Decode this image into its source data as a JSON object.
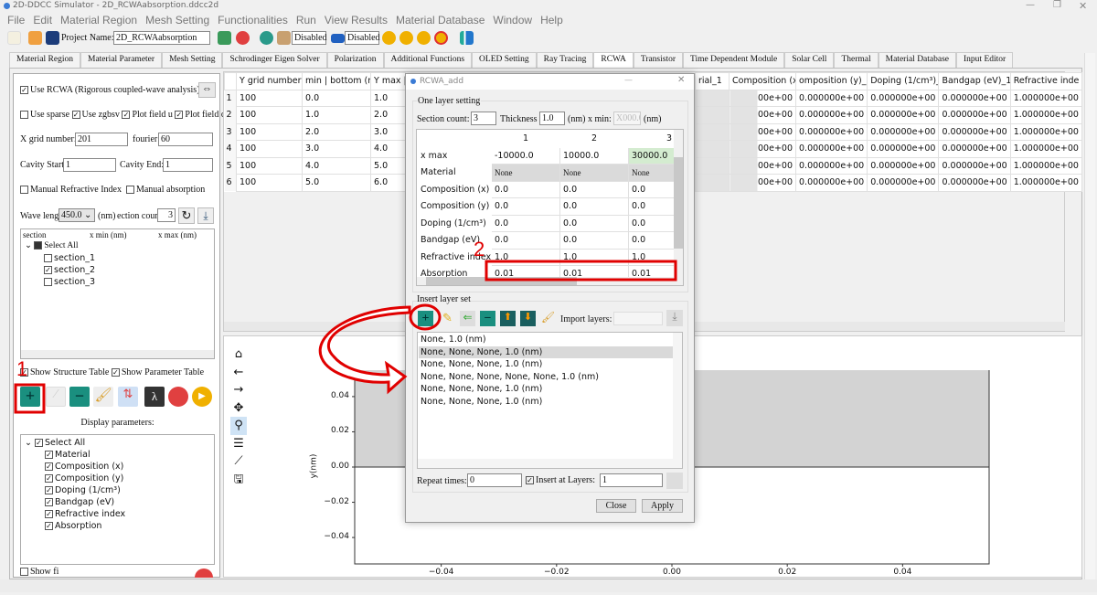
{
  "window": {
    "title": "2D-DDCC Simulator - 2D_RCWAabsorption.ddcc2d"
  },
  "menu": [
    "File",
    "Edit",
    "Material Region",
    "Mesh Setting",
    "Functionalities",
    "Run",
    "View Results",
    "Material Database",
    "Window",
    "Help"
  ],
  "toolbar": {
    "project_label": "Project Name:",
    "project_name": "2D_RCWAabsorption",
    "disabled_1": "Disabled",
    "disabled_2": "Disabled"
  },
  "tabs": [
    "Material Region",
    "Material Parameter",
    "Mesh Setting",
    "Schrodinger Eigen Solver",
    "Polarization",
    "Additional Functions",
    "OLED Setting",
    "Ray Tracing",
    "RCWA",
    "Transistor",
    "Time Dependent Module",
    "Solar Cell",
    "Thermal",
    "Material Database",
    "Input Editor"
  ],
  "active_tab": "RCWA",
  "left": {
    "use_rcwa": "Use RCWA (Rigorous coupled-wave analysis)",
    "use_sparse": "Use sparse",
    "use_zgbsv": "Use zgbsv",
    "plot_u": "Plot field u",
    "plot_d": "Plot field d",
    "xgrid_label": "X grid number:",
    "xgrid": "201",
    "fourier_label": "fourier:",
    "fourier": "60",
    "cav_start_label": "Cavity Start:",
    "cav_start": "1",
    "cav_end_label": "Cavity End:",
    "cav_end": "1",
    "manual_ri": "Manual Refractive Index",
    "manual_abs": "Manual absorption",
    "wave_label": "Wave lengt",
    "wave": "450.0",
    "nm": "(nm)",
    "section_count_label": "ection coun",
    "section_count": "3",
    "section_tree": {
      "headers": [
        "section",
        "x min (nm)",
        "x max (nm)"
      ],
      "select_all": "Select All",
      "items": [
        {
          "label": "section_1",
          "checked": false
        },
        {
          "label": "section_2",
          "checked": true
        },
        {
          "label": "section_3",
          "checked": false
        }
      ]
    },
    "show_structure": "Show Structure Table",
    "show_parameter": "Show Parameter Table",
    "display_label": "Display parameters:",
    "display_tree": {
      "select_all": "Select All",
      "items": [
        "Material",
        "Composition (x)",
        "Composition (y)",
        "Doping (1/cm³)",
        "Bandgap (eV)",
        "Refractive index",
        "Absorption"
      ]
    },
    "bottom_cut": "Show fi"
  },
  "main_table": {
    "headers": [
      "Y grid number",
      "min | bottom (nr",
      "Y max | t"
    ],
    "rows": [
      [
        "1",
        "100",
        "0.0",
        "1.0"
      ],
      [
        "2",
        "100",
        "1.0",
        "2.0"
      ],
      [
        "3",
        "100",
        "2.0",
        "3.0"
      ],
      [
        "4",
        "100",
        "3.0",
        "4.0"
      ],
      [
        "5",
        "100",
        "4.0",
        "5.0"
      ],
      [
        "6",
        "100",
        "5.0",
        "6.0"
      ]
    ],
    "right_headers": [
      "rial_1",
      "Composition (x)_",
      "omposition (y)_",
      "Doping (1/cm³)_",
      "Bandgap (eV)_1",
      "Refractive inde"
    ],
    "right_row": [
      "",
      "00e+00",
      "0.000000e+00",
      "0.000000e+00",
      "0.000000e+00",
      "1.000000e+00"
    ]
  },
  "dialog": {
    "title": "RCWA_add",
    "group1": "One layer setting",
    "section_count_label": "Section count:",
    "section_count": "3",
    "thickness_label": "Thickness",
    "thickness": "1.0",
    "nm_xmin": "(nm) x min:",
    "xmin": "X000.0",
    "nm": "(nm)",
    "columns": [
      "1",
      "2",
      "3"
    ],
    "rows": [
      {
        "label": "x max",
        "values": [
          "-10000.0",
          "10000.0",
          "30000.0"
        ]
      },
      {
        "label": "Material",
        "values": [
          "None",
          "None",
          "None"
        ]
      },
      {
        "label": "Composition (x)",
        "values": [
          "0.0",
          "0.0",
          "0.0"
        ]
      },
      {
        "label": "Composition (y)",
        "values": [
          "0.0",
          "0.0",
          "0.0"
        ]
      },
      {
        "label": "Doping (1/cm³)",
        "values": [
          "0.0",
          "0.0",
          "0.0"
        ]
      },
      {
        "label": "Bandgap (eV)",
        "values": [
          "0.0",
          "0.0",
          "0.0"
        ]
      },
      {
        "label": "Refractive index",
        "values": [
          "1.0",
          "1.0",
          "1.0"
        ]
      },
      {
        "label": "Absorption",
        "values": [
          "0.01",
          "0.01",
          "0.01"
        ]
      }
    ],
    "group2": "Insert layer set",
    "import_label": "Import layers:",
    "layers": [
      "None,  1.0 (nm)",
      "None, None, None,  1.0 (nm)",
      "None, None, None,  1.0 (nm)",
      "None, None, None, None, None,  1.0 (nm)",
      "None, None, None,  1.0 (nm)",
      "None, None, None,  1.0 (nm)"
    ],
    "selected_layer": 1,
    "repeat_label": "Repeat times:",
    "repeat": "0",
    "insert_at_label": "Insert at Layers:",
    "insert_at": "1",
    "close": "Close",
    "apply": "Apply"
  },
  "annotations": {
    "step1": "1",
    "step2": "2",
    "color": "#e00000"
  },
  "chart_data": {
    "type": "area",
    "ylabel": "y(nm)",
    "xlabel": "",
    "xlim": [
      -0.055,
      0.055
    ],
    "ylim": [
      -0.055,
      0.055
    ],
    "xticks": [
      "−0.04",
      "−0.02",
      "0.00",
      "0.02",
      "0.04"
    ],
    "xtick_values": [
      -0.04,
      -0.02,
      0,
      0.02,
      0.04
    ],
    "yticks": [
      "0.04",
      "0.02",
      "0.00",
      "−0.02",
      "−0.04"
    ],
    "ytick_values": [
      0.04,
      0.02,
      0,
      -0.02,
      -0.04
    ],
    "regions": [
      {
        "x": [
          -0.055,
          0.055
        ],
        "y": [
          0,
          0.055
        ],
        "color": "#d3d3d3"
      }
    ],
    "grid": false
  },
  "colors": {
    "accent_teal": "#1a8f7f",
    "highlight_green": "#d4ecd0"
  }
}
